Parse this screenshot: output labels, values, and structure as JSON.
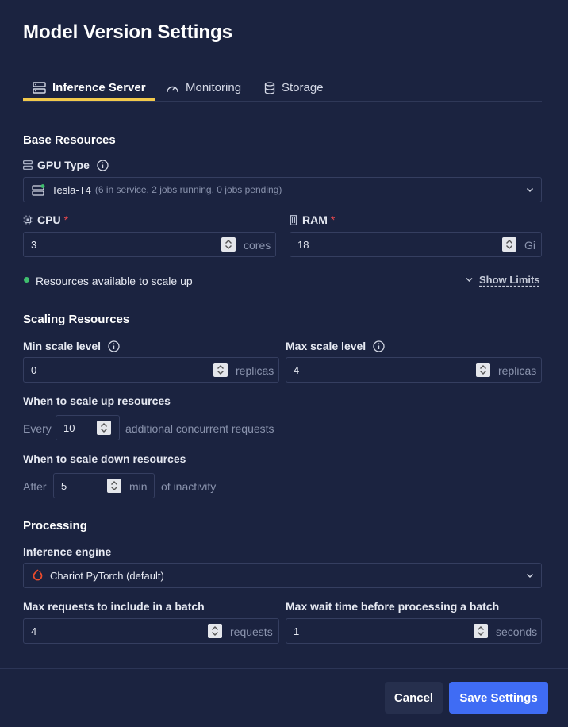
{
  "dialog": {
    "title": "Model Version Settings"
  },
  "tabs": [
    {
      "label": "Inference Server",
      "icon": "server-icon",
      "active": true
    },
    {
      "label": "Monitoring",
      "icon": "gauge-icon",
      "active": false
    },
    {
      "label": "Storage",
      "icon": "database-icon",
      "active": false
    }
  ],
  "base_resources": {
    "title": "Base Resources",
    "gpu": {
      "label": "GPU Type",
      "value": "Tesla-T4",
      "detail": "(6 in service, 2 jobs running, 0 jobs pending)"
    },
    "cpu": {
      "label": "CPU",
      "required": "*",
      "value": "3",
      "unit": "cores"
    },
    "ram": {
      "label": "RAM",
      "required": "*",
      "value": "18",
      "unit": "Gi"
    },
    "status": "Resources available to scale up",
    "show_limits": "Show Limits"
  },
  "scaling": {
    "title": "Scaling Resources",
    "min": {
      "label": "Min scale level",
      "value": "0",
      "unit": "replicas"
    },
    "max": {
      "label": "Max scale level",
      "value": "4",
      "unit": "replicas"
    },
    "scale_up": {
      "label": "When to scale up resources",
      "prefix": "Every",
      "value": "10",
      "suffix": "additional concurrent requests"
    },
    "scale_down": {
      "label": "When to scale down resources",
      "prefix": "After",
      "value": "5",
      "unit": "min",
      "suffix": "of inactivity"
    }
  },
  "processing": {
    "title": "Processing",
    "engine": {
      "label": "Inference engine",
      "value": "Chariot PyTorch (default)"
    },
    "max_requests": {
      "label": "Max requests to include in a batch",
      "value": "4",
      "unit": "requests"
    },
    "max_wait": {
      "label": "Max wait time before processing a batch",
      "value": "1",
      "unit": "seconds"
    }
  },
  "footer": {
    "cancel": "Cancel",
    "save": "Save Settings"
  },
  "colors": {
    "background": "#1b2340",
    "accent": "#3f6cf4",
    "tab_highlight": "#f2c94c",
    "status_ok": "#3fbf6e",
    "required": "#e5484d"
  }
}
